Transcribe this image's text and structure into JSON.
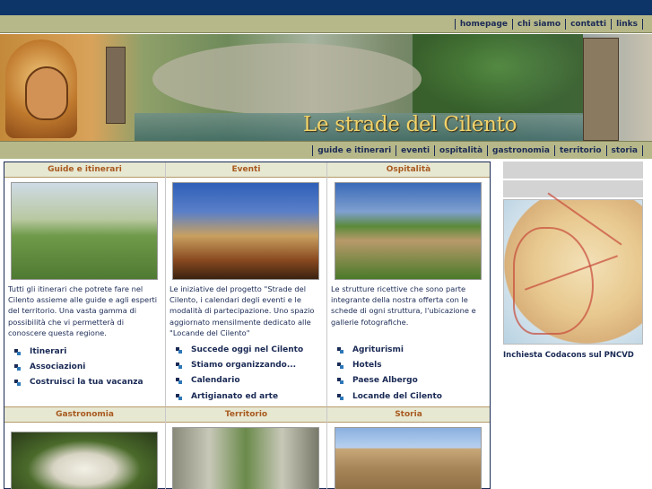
{
  "top_nav": [
    "homepage",
    "chi siamo",
    "contatti",
    "links"
  ],
  "banner": {
    "title": "Le strade del Cilento"
  },
  "section_nav": [
    "guide e itinerari",
    "eventi",
    "ospitalità",
    "gastronomia",
    "territorio",
    "storia"
  ],
  "sections": {
    "guide": {
      "title": "Guide e itinerari",
      "description": "Tutti gli itinerari che potrete fare nel Cilento assieme alle guide e agli esperti del territorio. Una vasta gamma di possibilità che vi permetterà di conoscere questa regione.",
      "links": [
        "Itinerari",
        "Associazioni",
        "Costruisci la tua vacanza"
      ]
    },
    "eventi": {
      "title": "Eventi",
      "description": "Le iniziative del progetto \"Strade del Cilento, i calendari degli eventi e le modalità di partecipazione. Uno spazio aggiornato mensilmente dedicato alle \"Locande del Cilento\"",
      "links": [
        "Succede oggi nel Cilento",
        "Stiamo organizzando...",
        "Calendario",
        "Artigianato ed arte"
      ]
    },
    "ospitalita": {
      "title": "Ospitalità",
      "description": "Le strutture ricettive che sono parte integrante della nostra offerta con le schede di ogni struttura, l'ubicazione e gallerie fotografiche.",
      "links": [
        "Agriturismi",
        "Hotels",
        "Paese Albergo",
        "Locande del Cilento"
      ]
    },
    "gastronomia": {
      "title": "Gastronomia"
    },
    "territorio": {
      "title": "Territorio"
    },
    "storia": {
      "title": "Storia"
    }
  },
  "sidebar": {
    "caption": "Inchiesta Codacons sul PNCVD"
  }
}
